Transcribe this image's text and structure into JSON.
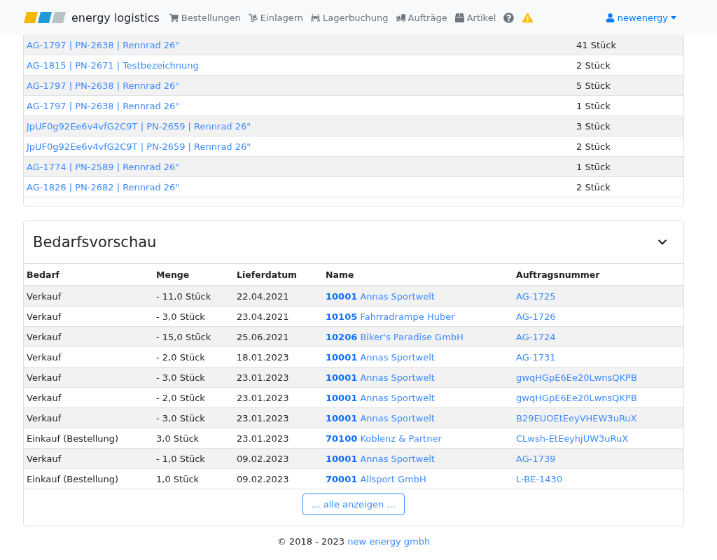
{
  "navbar": {
    "brand": "energy logistics",
    "items": [
      {
        "label": "Bestellungen",
        "kind": "cart"
      },
      {
        "label": "Einlagern",
        "kind": "dolly"
      },
      {
        "label": "Lagerbuchung",
        "kind": "carry"
      },
      {
        "label": "Aufträge",
        "kind": "truck"
      },
      {
        "label": "Artikel",
        "kind": "box"
      }
    ],
    "user": "newenergy"
  },
  "top_table": {
    "rows": [
      {
        "article": "AG-1797 | PN-2638 | Rennrad 26\"",
        "quantity": "41 Stück"
      },
      {
        "article": "AG-1815 | PN-2671 | Testbezeichnung",
        "quantity": "2 Stück"
      },
      {
        "article": "AG-1797 | PN-2638 | Rennrad 26\"",
        "quantity": "5 Stück"
      },
      {
        "article": "AG-1797 | PN-2638 | Rennrad 26\"",
        "quantity": "1 Stück"
      },
      {
        "article": "JpUF0g92Ee6v4vfG2C9T | PN-2659 | Rennrad 26\"",
        "quantity": "3 Stück"
      },
      {
        "article": "JpUF0g92Ee6v4vfG2C9T | PN-2659 | Rennrad 26\"",
        "quantity": "2 Stück"
      },
      {
        "article": "AG-1774 | PN-2589 | Rennrad 26\"",
        "quantity": "1 Stück"
      },
      {
        "article": "AG-1826 | PN-2682 | Rennrad 26\"",
        "quantity": "2 Stück"
      }
    ]
  },
  "forecast": {
    "title": "Bedarfsvorschau",
    "expanded": true,
    "columns": [
      "Bedarf",
      "Menge",
      "Lieferdatum",
      "Name",
      "Auftragsnummer"
    ],
    "rows": [
      {
        "need": "Verkauf",
        "quantity": "- 11,0 Stück",
        "date": "22.04.2021",
        "number": "10001",
        "name": "Annas Sportwelt",
        "order": "AG-1725"
      },
      {
        "need": "Verkauf",
        "quantity": "- 3,0 Stück",
        "date": "23.04.2021",
        "number": "10105",
        "name": "Fahrradrampe Huber",
        "order": "AG-1726"
      },
      {
        "need": "Verkauf",
        "quantity": "- 15,0 Stück",
        "date": "25.06.2021",
        "number": "10206",
        "name": "Biker's Paradise GmbH",
        "order": "AG-1724"
      },
      {
        "need": "Verkauf",
        "quantity": "- 2,0 Stück",
        "date": "18.01.2023",
        "number": "10001",
        "name": "Annas Sportwelt",
        "order": "AG-1731"
      },
      {
        "need": "Verkauf",
        "quantity": "- 3,0 Stück",
        "date": "23.01.2023",
        "number": "10001",
        "name": "Annas Sportwelt",
        "order": "gwqHGpE6Ee20LwnsQKPB"
      },
      {
        "need": "Verkauf",
        "quantity": "- 2,0 Stück",
        "date": "23.01.2023",
        "number": "10001",
        "name": "Annas Sportwelt",
        "order": "gwqHGpE6Ee20LwnsQKPB"
      },
      {
        "need": "Verkauf",
        "quantity": "- 3,0 Stück",
        "date": "23.01.2023",
        "number": "10001",
        "name": "Annas Sportwelt",
        "order": "B29EUOEtEeyVHEW3uRuX"
      },
      {
        "need": "Einkauf (Bestellung)",
        "quantity": "3,0 Stück",
        "date": "23.01.2023",
        "number": "70100",
        "name": "Koblenz & Partner",
        "order": "CLwsh-EtEeyhjUW3uRuX"
      },
      {
        "need": "Verkauf",
        "quantity": "- 1,0 Stück",
        "date": "09.02.2023",
        "number": "10001",
        "name": "Annas Sportwelt",
        "order": "AG-1739"
      },
      {
        "need": "Einkauf (Bestellung)",
        "quantity": "1,0 Stück",
        "date": "09.02.2023",
        "number": "70001",
        "name": "Allsport GmbH",
        "order": "L-BE-1430"
      }
    ],
    "show_all": "... alle anzeigen ..."
  },
  "footer": {
    "text": "© 2018 - 2023",
    "link": "new energy gmbh"
  }
}
